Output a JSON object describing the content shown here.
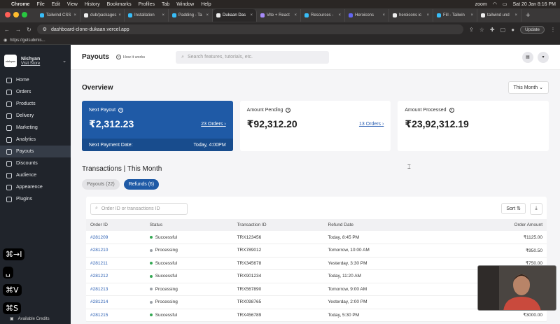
{
  "menubar": {
    "app": "Chrome",
    "items": [
      "File",
      "Edit",
      "View",
      "History",
      "Bookmarks",
      "Profiles",
      "Tab",
      "Window",
      "Help"
    ],
    "zoom": "zoom",
    "datetime": "Sat 20 Jan  8:16 PM"
  },
  "tabs": [
    {
      "label": "Tailwind CSS",
      "color": "#38bdf8"
    },
    {
      "label": "dub/packages",
      "color": "#eeeeee"
    },
    {
      "label": "Installation",
      "color": "#38bdf8"
    },
    {
      "label": "Padding - Ta",
      "color": "#38bdf8"
    },
    {
      "label": "Dukaan Das",
      "color": "#eeeeee",
      "active": true
    },
    {
      "label": "Vite + React",
      "color": "#a78bfa"
    },
    {
      "label": "Resources -",
      "color": "#38bdf8"
    },
    {
      "label": "Heroicons",
      "color": "#6366f1"
    },
    {
      "label": "heroicons ic",
      "color": "#eeeeee"
    },
    {
      "label": "Fill - Tailwin",
      "color": "#38bdf8"
    },
    {
      "label": "tailwind und",
      "color": "#eeeeee"
    }
  ],
  "address": {
    "url": "dashboard-clone-dukaan.vercel.app",
    "update_label": "Update"
  },
  "bookmark": "https://getsubmis...",
  "sidebar": {
    "store_logo": "nishyan",
    "store_name": "Nishyan",
    "visit_store": "Visit Store",
    "items": [
      {
        "label": "Home",
        "icon": "home-icon"
      },
      {
        "label": "Orders",
        "icon": "orders-icon"
      },
      {
        "label": "Products",
        "icon": "products-icon"
      },
      {
        "label": "Delivery",
        "icon": "delivery-icon"
      },
      {
        "label": "Marketing",
        "icon": "marketing-icon"
      },
      {
        "label": "Analytics",
        "icon": "analytics-icon"
      },
      {
        "label": "Payouts",
        "icon": "payouts-icon",
        "active": true
      },
      {
        "label": "Discounts",
        "icon": "discounts-icon"
      },
      {
        "label": "Audience",
        "icon": "audience-icon"
      },
      {
        "label": "Appearence",
        "icon": "appearance-icon"
      },
      {
        "label": "Plugins",
        "icon": "plugins-icon"
      }
    ],
    "credits_label": "Available Credits"
  },
  "shortcuts": [
    "⌘→I",
    "␣",
    "⌘V",
    "⌘S"
  ],
  "header": {
    "title": "Payouts",
    "how_it_works": "How it works",
    "search_placeholder": "Search features, tutorials, etc."
  },
  "overview": {
    "title": "Overview",
    "period": "This Month",
    "cards": [
      {
        "label": "Next Payout",
        "value": "₹2,312.23",
        "link": "23 Orders",
        "footer_label": "Next Payment Date:",
        "footer_value": "Today, 4:00PM"
      },
      {
        "label": "Amount Pending",
        "value": "₹92,312.20",
        "link": "13 Orders"
      },
      {
        "label": "Amount Processed",
        "value": "₹23,92,312.19"
      }
    ]
  },
  "transactions": {
    "title": "Transactions | This Month",
    "tabs": [
      {
        "label": "Payouts (22)"
      },
      {
        "label": "Refunds (6)",
        "active": true
      }
    ],
    "search_placeholder": "Order ID or transactions ID",
    "sort_label": "Sort",
    "columns": [
      "Order ID",
      "Status",
      "Transaction ID",
      "Refund Date",
      "Order Amount"
    ],
    "rows": [
      {
        "id": "#281209",
        "status": "Successful",
        "tx": "TRX123456",
        "date": "Today, 8:45 PM",
        "amount": "₹1125.00"
      },
      {
        "id": "#281210",
        "status": "Processing",
        "tx": "TRX789012",
        "date": "Tomorrow, 10:00 AM",
        "amount": "₹950.50"
      },
      {
        "id": "#281211",
        "status": "Successful",
        "tx": "TRX345678",
        "date": "Yesterday, 3:30 PM",
        "amount": "₹750.00"
      },
      {
        "id": "#281212",
        "status": "Successful",
        "tx": "TRX901234",
        "date": "Today, 11:20 AM",
        "amount": ""
      },
      {
        "id": "#281213",
        "status": "Processing",
        "tx": "TRX567890",
        "date": "Tomorrow, 9:00 AM",
        "amount": ""
      },
      {
        "id": "#281214",
        "status": "Processing",
        "tx": "TRX098765",
        "date": "Yesterday, 2:00 PM",
        "amount": ""
      },
      {
        "id": "#281215",
        "status": "Successful",
        "tx": "TRX456789",
        "date": "Today, 5:30 PM",
        "amount": "₹3000.00"
      }
    ]
  },
  "colors": {
    "success": "#34a853",
    "processing": "#9aa0a6",
    "primary": "#1f5aa6"
  }
}
